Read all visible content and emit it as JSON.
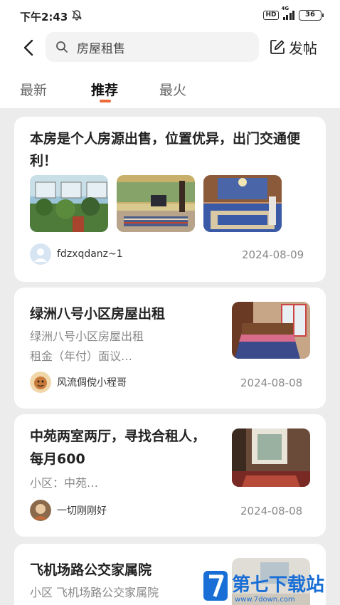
{
  "status_bar": {
    "time": "下午2:43",
    "hd": "HD",
    "network": "4G",
    "battery": "36"
  },
  "search": {
    "value": "房屋租售"
  },
  "post_button": {
    "label": "发帖"
  },
  "tabs": [
    {
      "label": "最新"
    },
    {
      "label": "推荐"
    },
    {
      "label": "最火"
    }
  ],
  "posts": [
    {
      "title": "本房是个人房源出售，位置优异，出门交通便利！",
      "author": "fdzxqdanz~1",
      "date": "2024-08-09"
    },
    {
      "title": "绿洲八号小区房屋出租",
      "desc_line1": "绿洲八号小区房屋出租",
      "desc_line2": "租金（年付）面议…",
      "author": "风流倜傥小程哥",
      "date": "2024-08-08"
    },
    {
      "title_line1": "中苑两室两厅，寻找合租人，",
      "title_line2": "每月600",
      "desc_line1": "小区：中苑…",
      "author": "一切刚刚好",
      "date": "2024-08-08"
    },
    {
      "title": "飞机场路公交家属院",
      "desc_line1": "小区 飞机场路公交家属院"
    }
  ],
  "watermark": {
    "text": "第七下载站",
    "url": "www.7down.com"
  }
}
